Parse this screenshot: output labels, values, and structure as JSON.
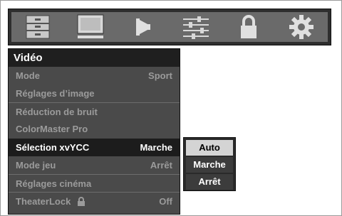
{
  "tabs": [
    {
      "icon": "settings-menu-icon",
      "label": ""
    },
    {
      "icon": "picture-monitor-icon",
      "label": ""
    },
    {
      "icon": "audio-speaker-icon",
      "label": ""
    },
    {
      "icon": "adjustment-sliders-icon",
      "label": ""
    },
    {
      "icon": "lock-icon",
      "label": ""
    },
    {
      "icon": "gear-icon",
      "label": ""
    }
  ],
  "menu": {
    "title": "Vidéo",
    "items": [
      {
        "label": "Mode",
        "value": "Sport",
        "state": "disabled"
      },
      {
        "label": "Réglages d’image",
        "value": "",
        "state": "disabled"
      },
      {
        "label": "Réduction de bruit",
        "value": "",
        "state": "disabled"
      },
      {
        "label": "ColorMaster Pro",
        "value": "",
        "state": "disabled"
      },
      {
        "label": "Sélection xvYCC",
        "value": "Marche",
        "state": "selected"
      },
      {
        "label": "Mode jeu",
        "value": "Arrêt",
        "state": "disabled"
      },
      {
        "label": "Réglages cinéma",
        "value": "",
        "state": "disabled"
      },
      {
        "label": "TheaterLock",
        "value": "Off",
        "state": "disabled",
        "icon": "lock-icon"
      }
    ]
  },
  "submenu": {
    "options": [
      "Auto",
      "Marche",
      "Arrêt"
    ],
    "highlighted": "Auto"
  },
  "colors": {
    "panel": "#4a4a4a",
    "selected_row": "#1c1c1c",
    "disabled_text": "#9b9b9b",
    "highlight": "#d4d4d4"
  }
}
